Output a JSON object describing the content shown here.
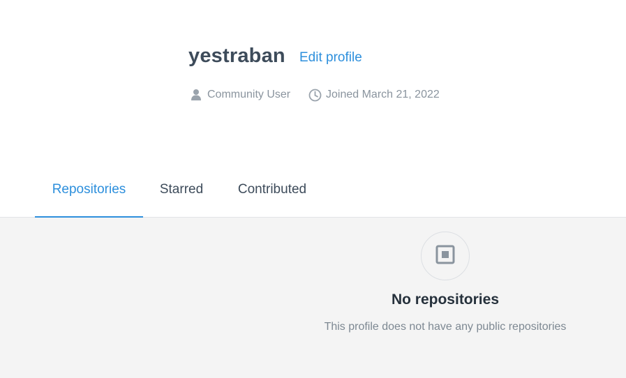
{
  "profile": {
    "username": "yestraban",
    "edit_label": "Edit profile",
    "role": "Community User",
    "joined": "Joined March 21, 2022"
  },
  "tabs": [
    {
      "label": "Repositories",
      "active": true
    },
    {
      "label": "Starred",
      "active": false
    },
    {
      "label": "Contributed",
      "active": false
    }
  ],
  "empty_state": {
    "icon": "repository-icon",
    "title": "No repositories",
    "subtitle": "This profile does not have any public repositories"
  },
  "colors": {
    "accent": "#2d8fdc",
    "text_primary": "#3d4b5a",
    "text_muted": "#8a949e",
    "content_bg": "#f4f4f4"
  },
  "icons": {
    "role": "user-icon",
    "joined": "clock-icon"
  }
}
